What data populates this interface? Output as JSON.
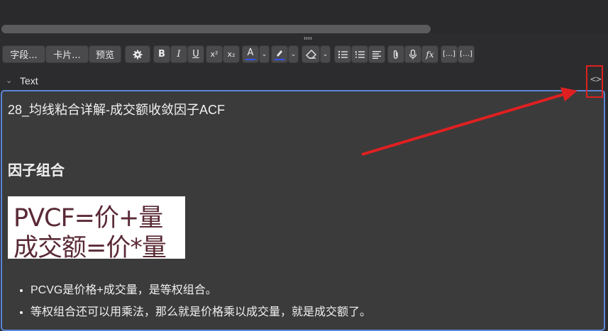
{
  "toolbar": {
    "fields_label": "字段...",
    "cards_label": "卡片...",
    "preview_label": "预览",
    "bold_label": "B",
    "italic_label": "I",
    "underline_label": "U",
    "superscript_label": "x²",
    "subscript_label": "x₂",
    "text_color_label": "A",
    "text_color": "#3355ff",
    "highlight_color": "#3355ff"
  },
  "field": {
    "label": "Text",
    "toggle_label": "<>"
  },
  "note": {
    "title_line": "28_均线粘合详解-成交额收敛因子ACF",
    "heading": "因子组合",
    "image_lines": [
      "PVCF=价+量",
      "成交额=价*量"
    ],
    "bullets": [
      "PCVG是价格+成交量，是等权组合。",
      "等权组合还可以用乘法，那么就是价格乘以成交量，就是成交额了。"
    ]
  }
}
